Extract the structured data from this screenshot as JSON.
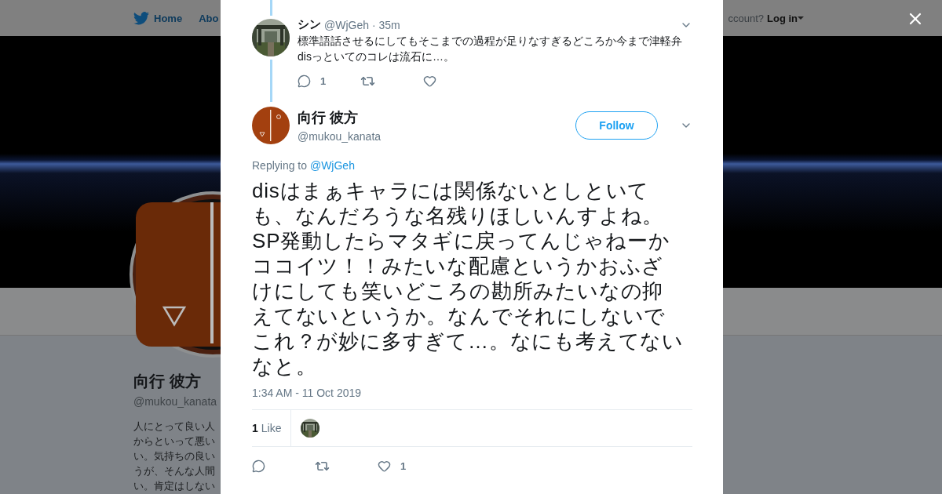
{
  "top_nav": {
    "home": "Home",
    "about": "Abo",
    "account_prompt": "ccount?",
    "login": "Log in"
  },
  "profile": {
    "name": "向行 彼方",
    "handle": "@mukou_kanata",
    "bio_lines": [
      "人にとって良い人",
      "からといって悪い",
      "い。気持ちの良い",
      "うが、そんな人間",
      "い。肯定はしない"
    ]
  },
  "reply": {
    "name": "シン",
    "handle": "@WjGeh",
    "time": "· 35m",
    "text": "標準語話させるにしてもそこまでの過程が足りなすぎるどころか今まで津軽弁disっといてのコレは流石に…。",
    "actions": [
      {
        "kind": "reply",
        "count": "1"
      },
      {
        "kind": "retweet"
      },
      {
        "kind": "like"
      }
    ]
  },
  "tweet": {
    "name": "向行 彼方",
    "handle": "@mukou_kanata",
    "follow": "Follow",
    "replying_prefix": "Replying to",
    "replying_to": "@WjGeh",
    "text_lines": [
      "disはまぁキャラには関係ないとしといて",
      "も、なんだろうな名残りほしいんすよね。",
      "SP発動したらマタギに戻ってんじゃねーか",
      "ココイツ！！みたいな配慮というかおふざ",
      "けにしても笑いどころの勘所みたいなの抑",
      "えてないというか。なんでそれにしないで",
      "これ？が妙に多すぎて…。なにも考えてない",
      "なと。"
    ],
    "timestamp": "1:34 AM - 11 Oct 2019",
    "likes_count": "1",
    "likes_label": "Like",
    "actions": [
      {
        "kind": "reply"
      },
      {
        "kind": "retweet"
      },
      {
        "kind": "like",
        "count": "1"
      }
    ]
  }
}
